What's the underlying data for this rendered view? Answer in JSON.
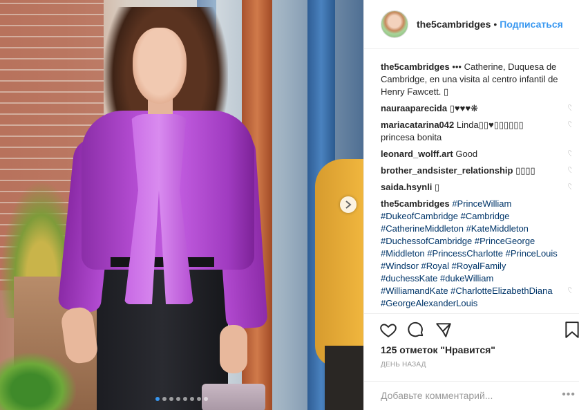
{
  "post": {
    "carousel": {
      "total_slides": 8,
      "active_slide": 1
    }
  },
  "header": {
    "username": "the5cambridges",
    "separator": "•",
    "follow_label": "Подписаться"
  },
  "caption": {
    "username": "the5cambridges",
    "text": " ••• Catherine, Duquesa de Cambridge, en una visita al centro infantil de Henry Fawcett. ▯"
  },
  "comments": [
    {
      "user": "nauraaparecida",
      "text": " ▯♥♥♥❋"
    },
    {
      "user": "mariacatarina042",
      "text": " Linda▯▯♥▯▯▯▯▯▯ princesa bonita"
    },
    {
      "user": "leonard_wolff.art",
      "text": " Good"
    },
    {
      "user": "brother_andsister_relationship",
      "text": " ▯▯▯▯"
    },
    {
      "user": "saida.hsynli",
      "text": " ▯"
    }
  ],
  "hashtag_comment": {
    "user": "the5cambridges",
    "tags": "#PrinceWilliam #DukeofCambridge #Cambridge #CatherineMiddleton #KateMiddleton #DuchessofCambridge #PrinceGeorge #Middleton #PrincessCharlotte #PrinceLouis #Windsor #Royal #RoyalFamily #duchessKate #dukeWilliam #WilliamandKate #CharlotteElizabethDiana #GeorgeAlexanderLouis"
  },
  "likes": "125 отметок \"Нравится\"",
  "time": "ДЕНЬ НАЗАД",
  "comment_input": {
    "placeholder": "Добавьте комментарий..."
  },
  "more_label": "•••",
  "icons": {
    "like": "heart-icon",
    "comment": "comment-bubble-icon",
    "share": "share-icon",
    "save": "bookmark-icon",
    "next": "chevron-right-icon"
  },
  "colors": {
    "link": "#3897f0",
    "hashtag": "#003569",
    "muted": "#999999"
  }
}
